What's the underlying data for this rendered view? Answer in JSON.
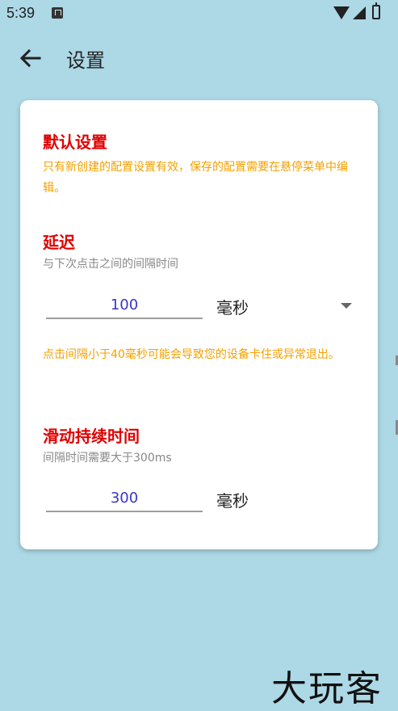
{
  "status_bar": {
    "time": "5:39"
  },
  "app_bar": {
    "title": "设置"
  },
  "default_settings": {
    "title": "默认设置",
    "note": "只有新创建的配置设置有效，保存的配置需要在悬停菜单中编辑。"
  },
  "delay": {
    "title": "延迟",
    "description": "与下次点击之间的间隔时间",
    "value": "100",
    "unit": "毫秒",
    "warning": "点击间隔小于40毫秒可能会导致您的设备卡住或异常退出。"
  },
  "swipe_duration": {
    "title": "滑动持续时间",
    "description": "间隔时间需要大于300ms",
    "value": "300",
    "unit": "毫秒"
  },
  "watermark": "大玩客"
}
